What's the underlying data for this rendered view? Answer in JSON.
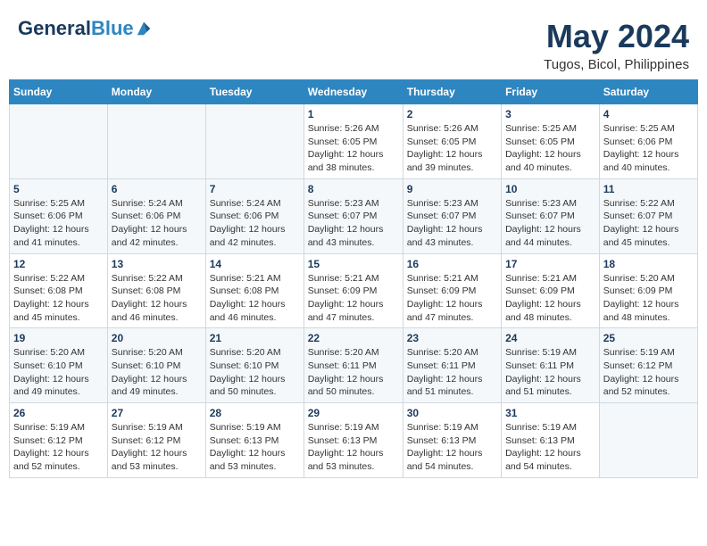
{
  "header": {
    "logo_line1": "General",
    "logo_line2": "Blue",
    "month_year": "May 2024",
    "location": "Tugos, Bicol, Philippines"
  },
  "weekdays": [
    "Sunday",
    "Monday",
    "Tuesday",
    "Wednesday",
    "Thursday",
    "Friday",
    "Saturday"
  ],
  "weeks": [
    [
      {
        "day": "",
        "sunrise": "",
        "sunset": "",
        "daylight": ""
      },
      {
        "day": "",
        "sunrise": "",
        "sunset": "",
        "daylight": ""
      },
      {
        "day": "",
        "sunrise": "",
        "sunset": "",
        "daylight": ""
      },
      {
        "day": "1",
        "sunrise": "Sunrise: 5:26 AM",
        "sunset": "Sunset: 6:05 PM",
        "daylight": "Daylight: 12 hours and 38 minutes."
      },
      {
        "day": "2",
        "sunrise": "Sunrise: 5:26 AM",
        "sunset": "Sunset: 6:05 PM",
        "daylight": "Daylight: 12 hours and 39 minutes."
      },
      {
        "day": "3",
        "sunrise": "Sunrise: 5:25 AM",
        "sunset": "Sunset: 6:05 PM",
        "daylight": "Daylight: 12 hours and 40 minutes."
      },
      {
        "day": "4",
        "sunrise": "Sunrise: 5:25 AM",
        "sunset": "Sunset: 6:06 PM",
        "daylight": "Daylight: 12 hours and 40 minutes."
      }
    ],
    [
      {
        "day": "5",
        "sunrise": "Sunrise: 5:25 AM",
        "sunset": "Sunset: 6:06 PM",
        "daylight": "Daylight: 12 hours and 41 minutes."
      },
      {
        "day": "6",
        "sunrise": "Sunrise: 5:24 AM",
        "sunset": "Sunset: 6:06 PM",
        "daylight": "Daylight: 12 hours and 42 minutes."
      },
      {
        "day": "7",
        "sunrise": "Sunrise: 5:24 AM",
        "sunset": "Sunset: 6:06 PM",
        "daylight": "Daylight: 12 hours and 42 minutes."
      },
      {
        "day": "8",
        "sunrise": "Sunrise: 5:23 AM",
        "sunset": "Sunset: 6:07 PM",
        "daylight": "Daylight: 12 hours and 43 minutes."
      },
      {
        "day": "9",
        "sunrise": "Sunrise: 5:23 AM",
        "sunset": "Sunset: 6:07 PM",
        "daylight": "Daylight: 12 hours and 43 minutes."
      },
      {
        "day": "10",
        "sunrise": "Sunrise: 5:23 AM",
        "sunset": "Sunset: 6:07 PM",
        "daylight": "Daylight: 12 hours and 44 minutes."
      },
      {
        "day": "11",
        "sunrise": "Sunrise: 5:22 AM",
        "sunset": "Sunset: 6:07 PM",
        "daylight": "Daylight: 12 hours and 45 minutes."
      }
    ],
    [
      {
        "day": "12",
        "sunrise": "Sunrise: 5:22 AM",
        "sunset": "Sunset: 6:08 PM",
        "daylight": "Daylight: 12 hours and 45 minutes."
      },
      {
        "day": "13",
        "sunrise": "Sunrise: 5:22 AM",
        "sunset": "Sunset: 6:08 PM",
        "daylight": "Daylight: 12 hours and 46 minutes."
      },
      {
        "day": "14",
        "sunrise": "Sunrise: 5:21 AM",
        "sunset": "Sunset: 6:08 PM",
        "daylight": "Daylight: 12 hours and 46 minutes."
      },
      {
        "day": "15",
        "sunrise": "Sunrise: 5:21 AM",
        "sunset": "Sunset: 6:09 PM",
        "daylight": "Daylight: 12 hours and 47 minutes."
      },
      {
        "day": "16",
        "sunrise": "Sunrise: 5:21 AM",
        "sunset": "Sunset: 6:09 PM",
        "daylight": "Daylight: 12 hours and 47 minutes."
      },
      {
        "day": "17",
        "sunrise": "Sunrise: 5:21 AM",
        "sunset": "Sunset: 6:09 PM",
        "daylight": "Daylight: 12 hours and 48 minutes."
      },
      {
        "day": "18",
        "sunrise": "Sunrise: 5:20 AM",
        "sunset": "Sunset: 6:09 PM",
        "daylight": "Daylight: 12 hours and 48 minutes."
      }
    ],
    [
      {
        "day": "19",
        "sunrise": "Sunrise: 5:20 AM",
        "sunset": "Sunset: 6:10 PM",
        "daylight": "Daylight: 12 hours and 49 minutes."
      },
      {
        "day": "20",
        "sunrise": "Sunrise: 5:20 AM",
        "sunset": "Sunset: 6:10 PM",
        "daylight": "Daylight: 12 hours and 49 minutes."
      },
      {
        "day": "21",
        "sunrise": "Sunrise: 5:20 AM",
        "sunset": "Sunset: 6:10 PM",
        "daylight": "Daylight: 12 hours and 50 minutes."
      },
      {
        "day": "22",
        "sunrise": "Sunrise: 5:20 AM",
        "sunset": "Sunset: 6:11 PM",
        "daylight": "Daylight: 12 hours and 50 minutes."
      },
      {
        "day": "23",
        "sunrise": "Sunrise: 5:20 AM",
        "sunset": "Sunset: 6:11 PM",
        "daylight": "Daylight: 12 hours and 51 minutes."
      },
      {
        "day": "24",
        "sunrise": "Sunrise: 5:19 AM",
        "sunset": "Sunset: 6:11 PM",
        "daylight": "Daylight: 12 hours and 51 minutes."
      },
      {
        "day": "25",
        "sunrise": "Sunrise: 5:19 AM",
        "sunset": "Sunset: 6:12 PM",
        "daylight": "Daylight: 12 hours and 52 minutes."
      }
    ],
    [
      {
        "day": "26",
        "sunrise": "Sunrise: 5:19 AM",
        "sunset": "Sunset: 6:12 PM",
        "daylight": "Daylight: 12 hours and 52 minutes."
      },
      {
        "day": "27",
        "sunrise": "Sunrise: 5:19 AM",
        "sunset": "Sunset: 6:12 PM",
        "daylight": "Daylight: 12 hours and 53 minutes."
      },
      {
        "day": "28",
        "sunrise": "Sunrise: 5:19 AM",
        "sunset": "Sunset: 6:13 PM",
        "daylight": "Daylight: 12 hours and 53 minutes."
      },
      {
        "day": "29",
        "sunrise": "Sunrise: 5:19 AM",
        "sunset": "Sunset: 6:13 PM",
        "daylight": "Daylight: 12 hours and 53 minutes."
      },
      {
        "day": "30",
        "sunrise": "Sunrise: 5:19 AM",
        "sunset": "Sunset: 6:13 PM",
        "daylight": "Daylight: 12 hours and 54 minutes."
      },
      {
        "day": "31",
        "sunrise": "Sunrise: 5:19 AM",
        "sunset": "Sunset: 6:13 PM",
        "daylight": "Daylight: 12 hours and 54 minutes."
      },
      {
        "day": "",
        "sunrise": "",
        "sunset": "",
        "daylight": ""
      }
    ]
  ]
}
